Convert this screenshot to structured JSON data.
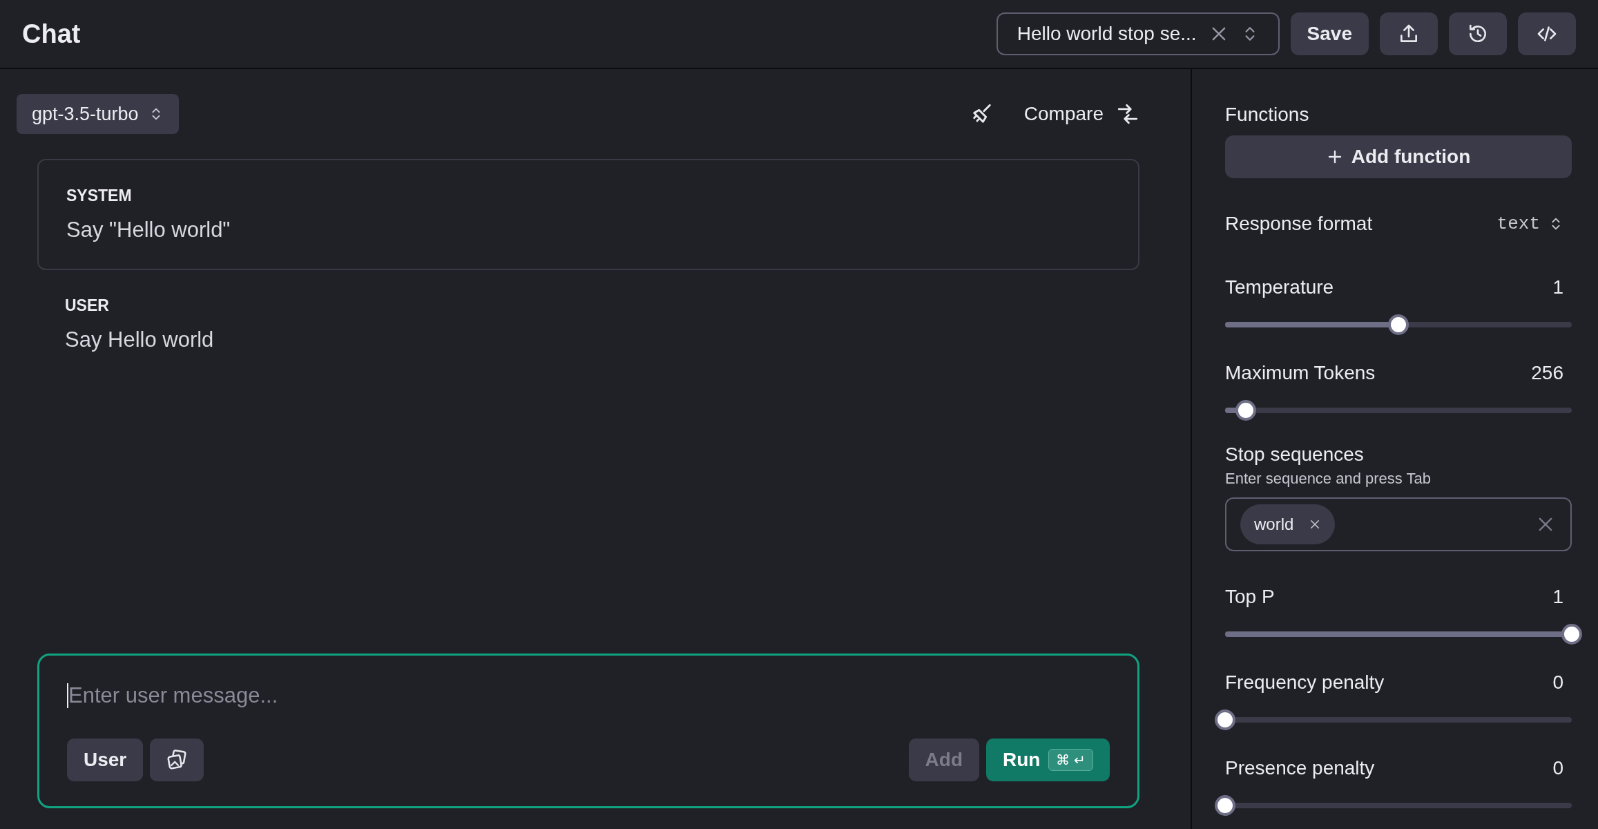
{
  "header": {
    "title": "Chat",
    "preset": {
      "value": "Hello world stop se..."
    },
    "buttons": [
      {
        "kind": "text",
        "label": "Save"
      },
      {
        "kind": "upload"
      },
      {
        "kind": "history"
      },
      {
        "kind": "code"
      }
    ]
  },
  "main": {
    "model": "gpt-3.5-turbo",
    "compare": "Compare",
    "messages": [
      {
        "role": "SYSTEM",
        "text": "Say \"Hello world\"",
        "boxed": true
      },
      {
        "role": "USER",
        "text": "Say Hello world",
        "boxed": false
      }
    ],
    "composer": {
      "placeholder": "Enter user message...",
      "role_button": "User",
      "add_button": {
        "label": "Add",
        "disabled": true
      },
      "run_button": {
        "label": "Run",
        "keys": [
          "⌘",
          "↵"
        ]
      }
    }
  },
  "settings": {
    "functions_label": "Functions",
    "add_function": "Add function",
    "response_format": {
      "label": "Response format",
      "value": "text"
    },
    "sliders_top": [
      {
        "label": "Temperature",
        "value": "1",
        "level": 0.5
      },
      {
        "label": "Maximum Tokens",
        "value": "256",
        "level": 0.06
      }
    ],
    "stop_sequences": {
      "label": "Stop sequences",
      "hint": "Enter sequence and press Tab",
      "tags": [
        "world"
      ]
    },
    "sliders_bottom": [
      {
        "label": "Top P",
        "value": "1",
        "level": 1
      },
      {
        "label": "Frequency penalty",
        "value": "0",
        "level": 0
      },
      {
        "label": "Presence penalty",
        "value": "0",
        "level": 0
      }
    ]
  }
}
